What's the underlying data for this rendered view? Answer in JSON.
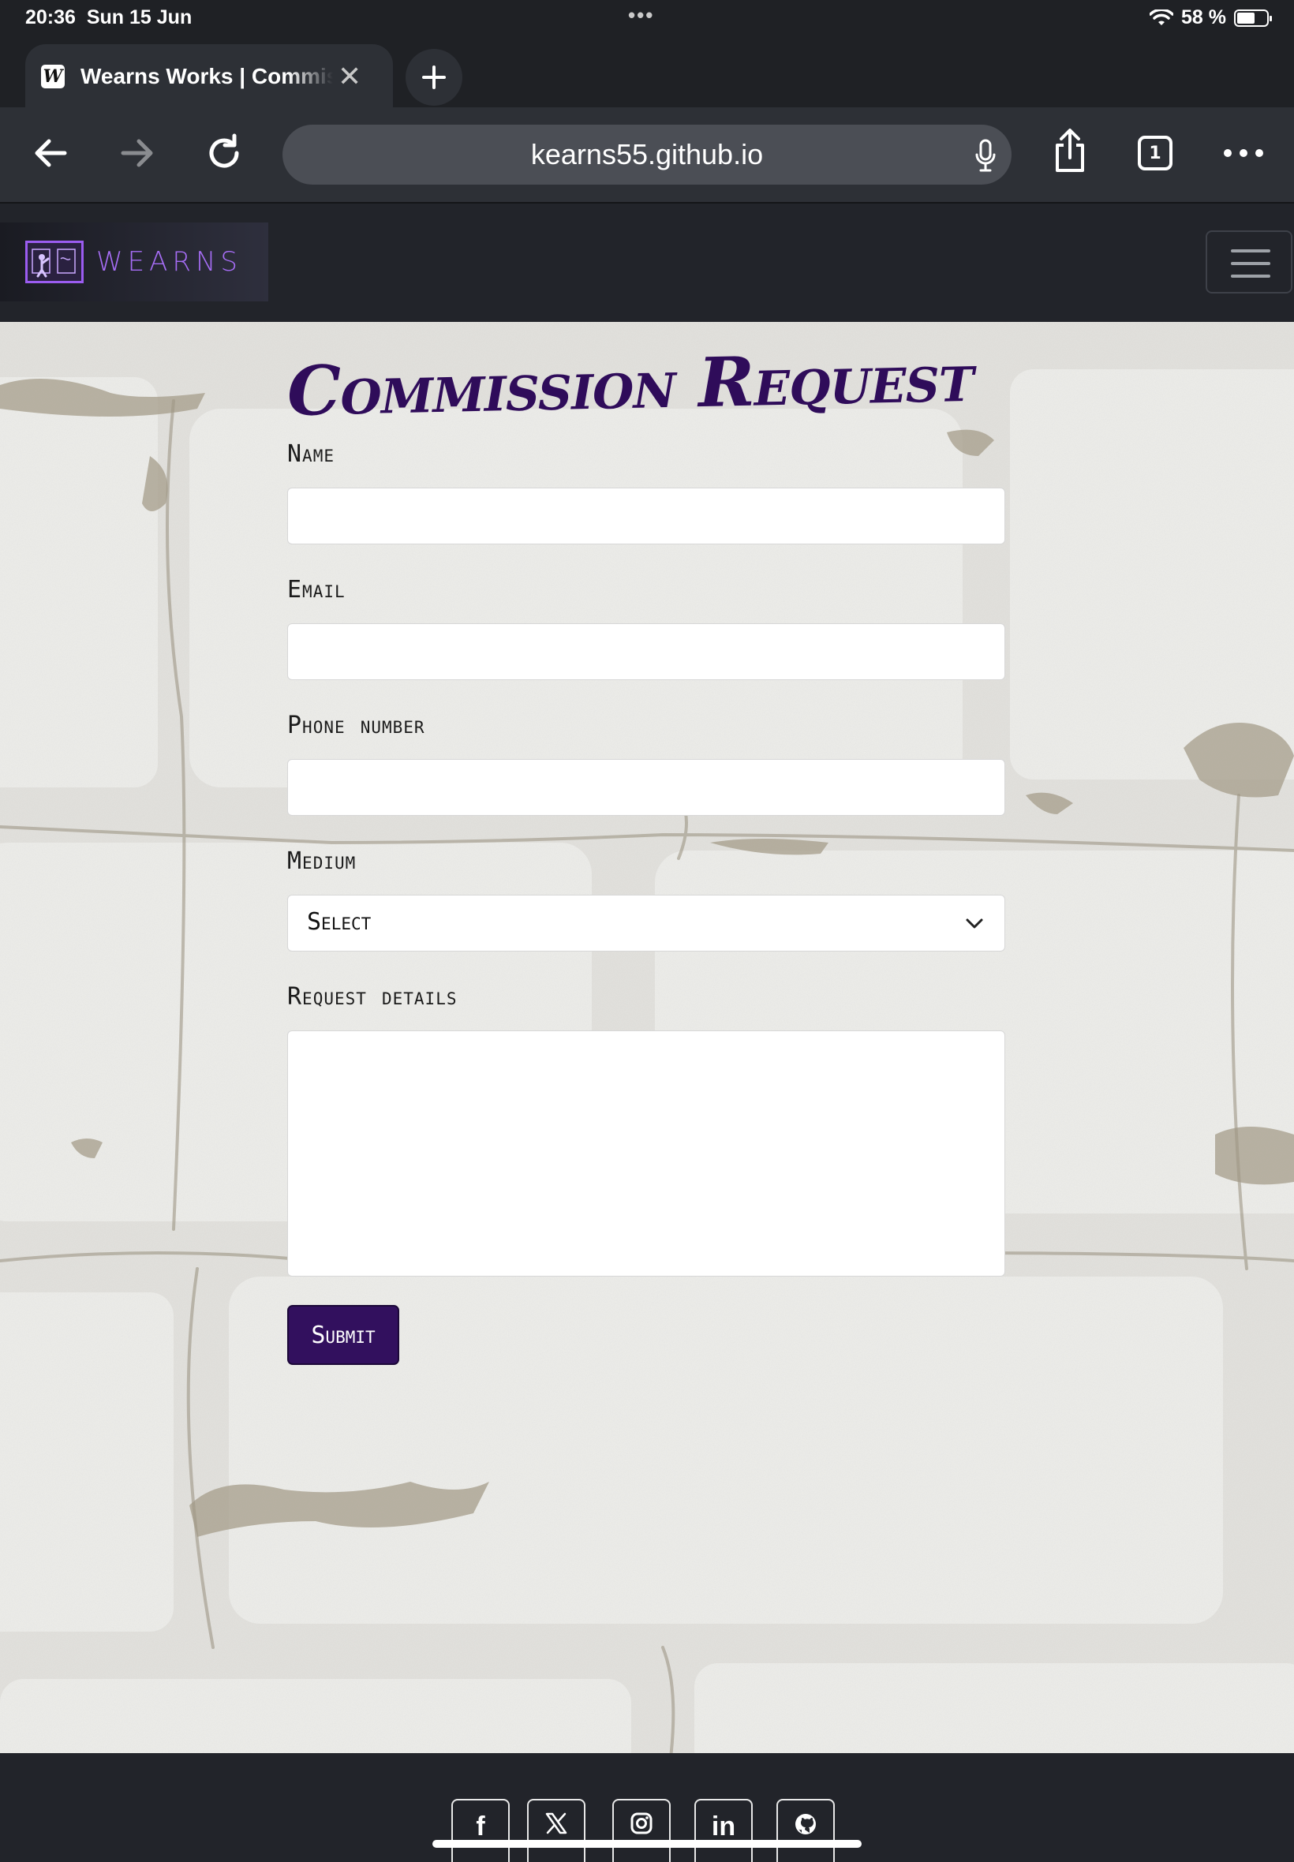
{
  "status_bar": {
    "time": "20:36",
    "date": "Sun 15 Jun",
    "battery_text": "58 %"
  },
  "browser": {
    "tab_title": "Wearns Works | Commission Request",
    "favicon_letter": "W",
    "url": "kearns55.github.io",
    "tab_count": "1"
  },
  "site": {
    "brand_name": "WEARNS",
    "accent_color": "#a66df5"
  },
  "form": {
    "heading": "Commission Request",
    "fields": {
      "name_label": "Name",
      "email_label": "Email",
      "phone_label": "Phone number",
      "medium_label": "Medium",
      "medium_value": "Select",
      "details_label": "Request details"
    },
    "submit_label": "Submit"
  },
  "footer": {
    "social_icons": [
      "facebook-icon",
      "x-icon",
      "instagram-icon",
      "linkedin-icon",
      "github-icon"
    ],
    "facebook_glyph": "f",
    "linkedin_glyph": "in"
  }
}
